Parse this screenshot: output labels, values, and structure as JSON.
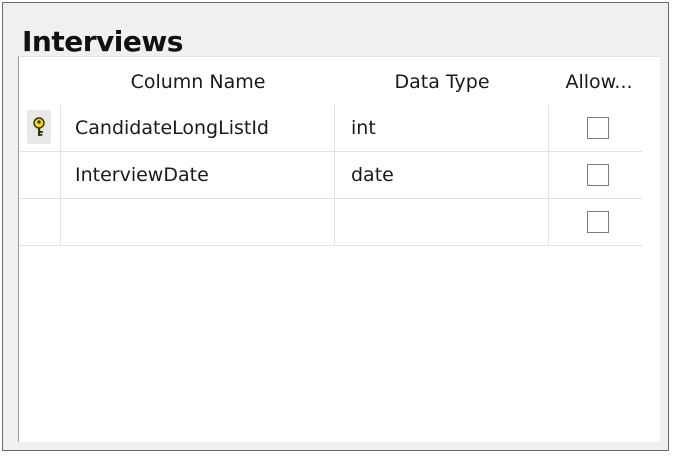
{
  "table": {
    "title": "Interviews",
    "columns": {
      "name": "Column Name",
      "type": "Data Type",
      "nulls": "Allow..."
    },
    "rows": [
      {
        "name": "CandidateLongListId",
        "type": "int",
        "allow_nulls": false,
        "primary_key": true,
        "icon": "primary-key-icon"
      },
      {
        "name": "InterviewDate",
        "type": "date",
        "allow_nulls": false,
        "primary_key": false
      },
      {
        "name": "",
        "type": "",
        "allow_nulls": false,
        "primary_key": false
      }
    ]
  },
  "colors": {
    "key_yellow": "#f0d21e",
    "border_dark": "#6b6b6b",
    "background": "#f0f0f0"
  }
}
